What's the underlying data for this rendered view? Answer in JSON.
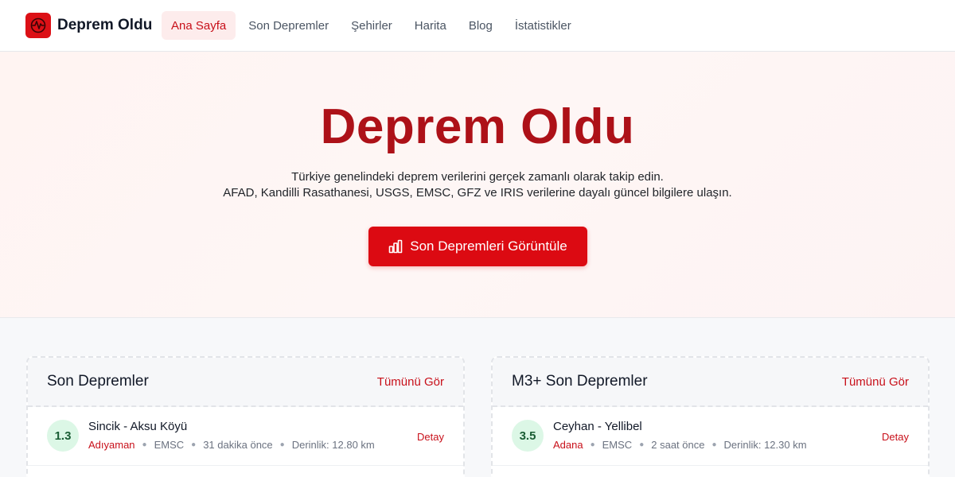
{
  "brand": {
    "name": "Deprem Oldu",
    "logo_icon": "seismograph-logo-icon",
    "accent": "#dc1016"
  },
  "nav": {
    "items": [
      {
        "label": "Ana Sayfa",
        "active": true
      },
      {
        "label": "Son Depremler",
        "active": false
      },
      {
        "label": "Şehirler",
        "active": false
      },
      {
        "label": "Harita",
        "active": false
      },
      {
        "label": "Blog",
        "active": false
      },
      {
        "label": "İstatistikler",
        "active": false
      }
    ]
  },
  "hero": {
    "title": "Deprem Oldu",
    "subtitle_line1": "Türkiye genelindeki deprem verilerini gerçek zamanlı olarak takip edin.",
    "subtitle_line2": "AFAD, Kandilli Rasathanesi, USGS, EMSC, GFZ ve IRIS verilerine dayalı güncel bilgilere ulaşın.",
    "button_label": "Son Depremleri Görüntüle",
    "button_icon": "bar-chart-icon",
    "title_color": "#ad1118",
    "button_color": "#dc0a12"
  },
  "recent": {
    "title": "Son Depremler",
    "link_label": "Tümünü Gör",
    "items": [
      {
        "magnitude": "1.3",
        "place": "Sincik - Aksu Köyü",
        "city": "Adıyaman",
        "source": "EMSC",
        "time": "31 dakika önce",
        "depth": "Derinlik: 12.80 km",
        "detail_label": "Detay"
      }
    ]
  },
  "m3": {
    "title": "M3+ Son Depremler",
    "link_label": "Tümünü Gör",
    "items": [
      {
        "magnitude": "3.5",
        "place": "Ceyhan - Yellibel",
        "city": "Adana",
        "source": "EMSC",
        "time": "2 saat önce",
        "depth": "Derinlik: 12.30 km",
        "detail_label": "Detay"
      }
    ]
  }
}
